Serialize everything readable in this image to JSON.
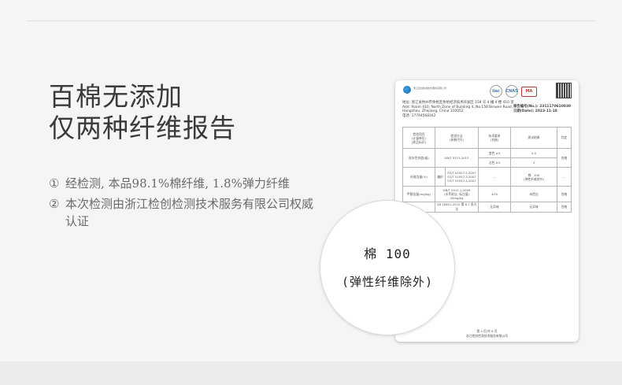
{
  "headline": {
    "line1": "百棉无添加",
    "line2": "仅两种纤维报告"
  },
  "points": [
    {
      "num": "①",
      "text": "经检测, 本品98.1%棉纤维, 1.8%弹力纤维"
    },
    {
      "num": "②",
      "text": "本次检测由浙江检创检测技术服务有限公司权威认证"
    }
  ],
  "report": {
    "company": "浙江检创检测技术服务有限公司",
    "badges": [
      "ilac",
      "CNAS",
      "MA"
    ],
    "address": [
      "地址: 浙江省杭州市余杭区余杭经济技术开发区 158 号 4 幢 4 楼 410 室",
      "Add: Room 410, North Zone of Building 4, No.158 Binwen Road,",
      "Hangzhou, Zhejiang, China    310052",
      "电话: 17794568162"
    ],
    "report_no_label": "报告编号(No.):",
    "report_no": "2311170610030",
    "date_label": "日期(Date):",
    "date": "2023-11-18",
    "header": [
      "检验项目",
      "检测方法",
      "技术要求",
      "测试结果",
      "判定"
    ],
    "header_sub": [
      "(计量单位)",
      "(参数代号)",
      "(合格)"
    ],
    "header_sub2": "[样品标识]",
    "rows": {
      "r1_item": "耐水色牢度(级)",
      "r1_method": "GB/T 5713-2013",
      "r1_req_a": "变色 ≥3",
      "r1_res_a": "4-5",
      "r1_req_b": "沾色 ≥3",
      "r1_res_b": "3",
      "r1_verdict": "合格",
      "r2_item": "纤维含量(%)",
      "r2_sub": "编织",
      "r2_methods": [
        "FZ/T 01057.2-2007",
        "FZ/T 01057.3-2007",
        "FZ/T 01057.4-2007"
      ],
      "r2_req": "--",
      "r2_res_name": "棉",
      "r2_res_val": "100",
      "r2_res_note": "(弹性纤维除外)",
      "r2_verdict": "--",
      "r3_item": "甲醛含量(mg/kg)",
      "r3_methods": [
        "GB/T 2912.1-2009",
        "(水萃取法, 标注值)",
        "20mg/kg"
      ],
      "r3_req": "≤75",
      "r3_res": "未检出",
      "r3_verdict": "合格",
      "r4_method": "GB 18401-2010 第 6.7 条方法",
      "r4_req": "无异味",
      "r4_res": "无异味",
      "r4_verdict": "合格"
    },
    "page": "第 4 页/共 6 页",
    "footer_company": "浙江检创检测技术服务有限公司"
  },
  "circle": {
    "line1": "棉 100",
    "line2": "(弹性纤维除外)"
  }
}
